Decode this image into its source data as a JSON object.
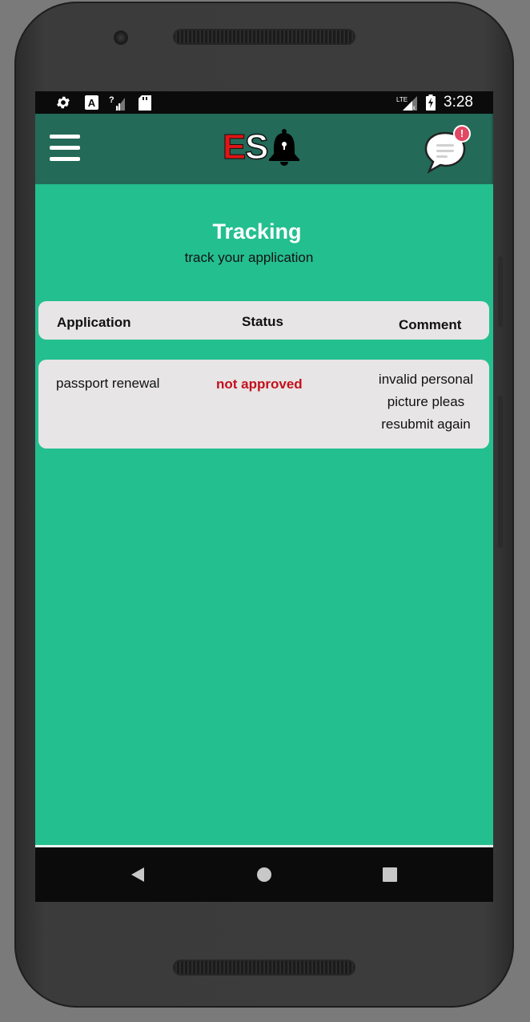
{
  "status_bar": {
    "time": "3:28",
    "network": "LTE",
    "icons": [
      "settings-icon",
      "font-a-icon",
      "signal-unknown-icon",
      "sd-card-icon",
      "lte-signal-icon",
      "battery-charging-icon"
    ]
  },
  "header": {
    "menu_icon": "hamburger-menu-icon",
    "logo": {
      "letter_e": "E",
      "letter_s": "S",
      "bell": "bell-icon",
      "colors": {
        "e": "#e01515",
        "s": "#ffffff",
        "bell": "#000000"
      }
    },
    "chat_icon": "chat-bubble-icon",
    "notification_badge": "!"
  },
  "page": {
    "title": "Tracking",
    "subtitle": "track your application"
  },
  "table": {
    "headers": {
      "application": "Application",
      "status": "Status",
      "comment": "Comment"
    },
    "rows": [
      {
        "application": "passport renewal",
        "status": "not approved",
        "comment_lines": [
          "invalid personal",
          "picture pleas",
          "resubmit again"
        ]
      }
    ]
  },
  "colors": {
    "screen_bg": "#24bf8e",
    "app_bar": "#236a58",
    "card_bg": "#e7e5e5",
    "status_rejected": "#c4101c",
    "badge": "#e24763"
  },
  "nav_bar": {
    "back": "back-triangle-icon",
    "home": "home-circle-icon",
    "recents": "recents-square-icon"
  }
}
